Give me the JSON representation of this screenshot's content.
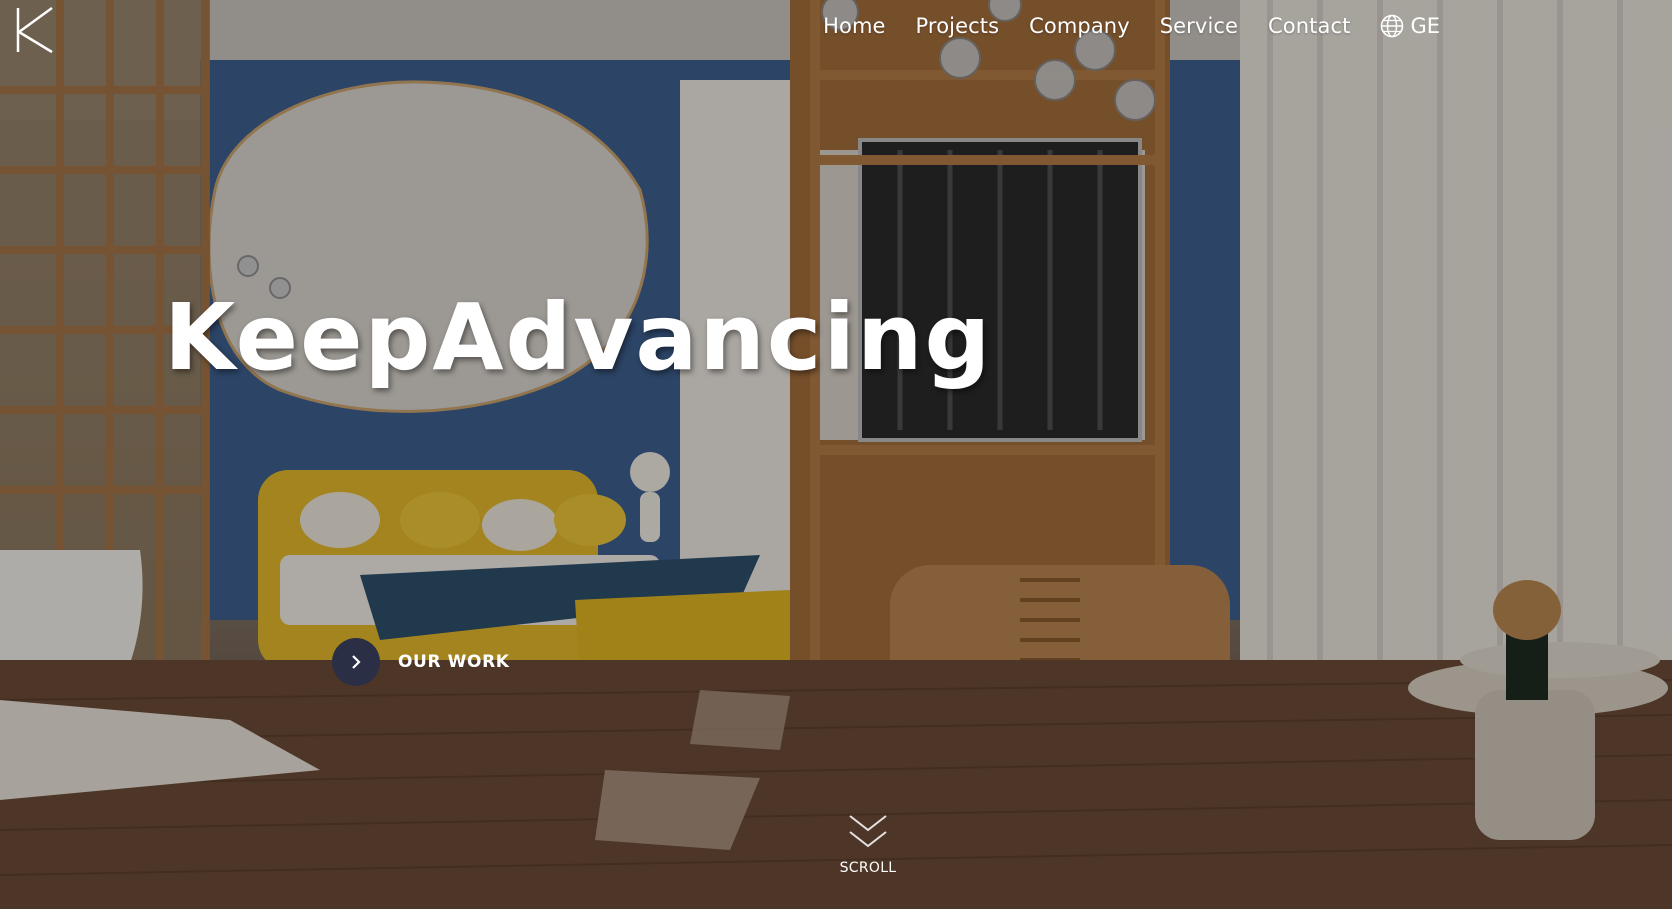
{
  "header": {
    "logo_name": "K-logo",
    "nav": [
      {
        "label": "Home"
      },
      {
        "label": "Projects"
      },
      {
        "label": "Company"
      },
      {
        "label": "Service"
      },
      {
        "label": "Contact"
      }
    ],
    "language": {
      "label": "GE",
      "icon": "globe-icon"
    }
  },
  "hero": {
    "headline": "KeepAdvancing",
    "cta_label": "OUR WORK",
    "scroll_label": "SCROLL"
  },
  "colors": {
    "text": "#ffffff",
    "cta_circle": "#2a2f45",
    "wall_blue": "#3d5f8e",
    "bed_yellow": "#e2b82a",
    "wood": "#9a6a3a"
  }
}
